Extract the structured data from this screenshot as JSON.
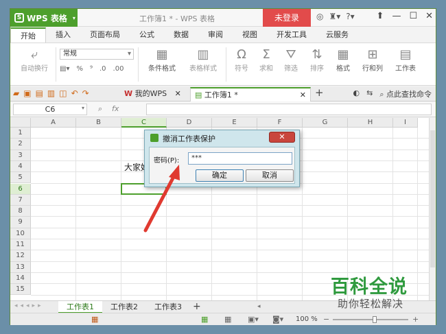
{
  "app": {
    "name": "WPS 表格",
    "window_title": "工作簿1 * - WPS 表格",
    "login_label": "未登录",
    "brand_color": "#4d9f2c"
  },
  "ribbon_tabs": [
    "开始",
    "插入",
    "页面布局",
    "公式",
    "数据",
    "审阅",
    "视图",
    "开发工具",
    "云服务"
  ],
  "ribbon": {
    "auto_wrap": "自动换行",
    "number_format": "常规",
    "percent": "%",
    "cond_format": "条件格式",
    "table_style": "表格样式",
    "symbol": "符号",
    "sum": "求和",
    "filter": "筛选",
    "sort": "排序",
    "format": "格式",
    "rows_cols": "行和列",
    "worksheet": "工作表"
  },
  "doc_tabs": {
    "mywps": "我的WPS",
    "workbook": "工作簿1 *",
    "find_cmd": "点此查找命令"
  },
  "formula_bar": {
    "name_box": "C6",
    "fx": "fx"
  },
  "columns": [
    "A",
    "B",
    "C",
    "D",
    "E",
    "F",
    "G",
    "H",
    "I"
  ],
  "rows": [
    "1",
    "2",
    "3",
    "4",
    "5",
    "6",
    "7",
    "8",
    "9",
    "10",
    "11",
    "12",
    "13",
    "14",
    "15"
  ],
  "cell_text": "大家好",
  "sheets": [
    "工作表1",
    "工作表2",
    "工作表3"
  ],
  "status": {
    "zoom": "100 %"
  },
  "dialog": {
    "title": "撤消工作表保护",
    "password_label": "密码(P):",
    "password_value": "***",
    "ok_label": "确定",
    "cancel_label": "取消"
  },
  "watermark": {
    "line1": "百科全说",
    "line2": "助你轻松解决"
  }
}
